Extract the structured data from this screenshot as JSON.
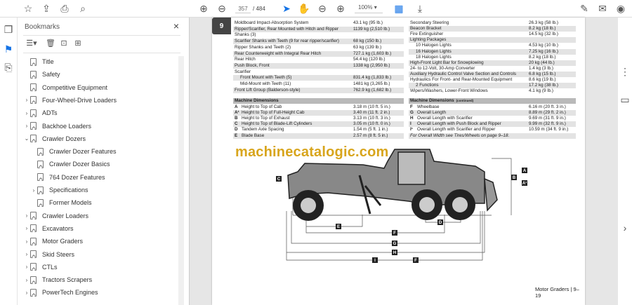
{
  "toolbar": {
    "page_current": "357",
    "page_total": "/ 484",
    "zoom": "100%",
    "icons": [
      "star-icon",
      "upload-icon",
      "print-icon",
      "search-icon",
      "page-up-icon",
      "page-down-icon",
      "select-cursor-icon",
      "hand-icon",
      "zoom-out-icon",
      "zoom-in-icon",
      "page-display-icon",
      "scroll-mode-icon",
      "sign-icon",
      "share-mail-icon",
      "account-icon"
    ]
  },
  "bookmarks": {
    "title": "Bookmarks",
    "close": "×",
    "items": [
      {
        "label": "Title",
        "level": 0,
        "expand": ""
      },
      {
        "label": "Safety",
        "level": 0,
        "expand": ""
      },
      {
        "label": "Competitive Equipment",
        "level": 0,
        "expand": ""
      },
      {
        "label": "Four-Wheel-Drive Loaders",
        "level": 0,
        "expand": "›"
      },
      {
        "label": "ADTs",
        "level": 0,
        "expand": "›"
      },
      {
        "label": "Backhoe Loaders",
        "level": 0,
        "expand": "›"
      },
      {
        "label": "Crawler Dozers",
        "level": 0,
        "expand": "⌄"
      },
      {
        "label": "Crawler Dozer Features",
        "level": 1,
        "expand": ""
      },
      {
        "label": "Crawler Dozer Basics",
        "level": 1,
        "expand": ""
      },
      {
        "label": "764 Dozer Features",
        "level": 1,
        "expand": ""
      },
      {
        "label": "Specifications",
        "level": 1,
        "expand": "›"
      },
      {
        "label": "Former Models",
        "level": 1,
        "expand": ""
      },
      {
        "label": "Crawler Loaders",
        "level": 0,
        "expand": "›"
      },
      {
        "label": "Excavators",
        "level": 0,
        "expand": "›"
      },
      {
        "label": "Motor Graders",
        "level": 0,
        "expand": "›"
      },
      {
        "label": "Skid Steers",
        "level": 0,
        "expand": "›"
      },
      {
        "label": "CTLs",
        "level": 0,
        "expand": "›"
      },
      {
        "label": "Tractors Scrapers",
        "level": 0,
        "expand": "›"
      },
      {
        "label": "PowerTech Engines",
        "level": 0,
        "expand": "›"
      }
    ]
  },
  "doc": {
    "left_options": [
      [
        "Moldboard Impact-Absorption System",
        "43.1 kg (95 lb.)",
        0
      ],
      [
        "Ripper/Scarifier, Rear Mounted with Hitch and Ripper",
        "1139 kg (2,510 lb.)",
        0
      ],
      [
        "Shanks (3)",
        "",
        0
      ],
      [
        "Scarifier Shanks with Teeth (9 for rear ripper/scarifier)",
        "68 kg (150 lb.)",
        0
      ],
      [
        "Ripper Shanks and Teeth (2)",
        "63 kg (139 lb.)",
        0
      ],
      [
        "Rear Counterweight with Integral Rear Hitch",
        "727.1 kg (1,603 lb.)",
        0
      ],
      [
        "Rear Hitch",
        "54.4 kg (120 lb.)",
        0
      ],
      [
        "Push Block, Front",
        "1338 kg (2,950 lb.)",
        0
      ],
      [
        "Scarifier",
        "",
        0
      ],
      [
        "Front Mount with Teeth (5)",
        "831.4 kg (1,833 lb.)",
        1
      ],
      [
        "Mid-Mount with Teeth (11)",
        "1481 kg (3,265 lb.)",
        1
      ],
      [
        "Front Lift Group (Balderson-style)",
        "762.9 kg (1,682 lb.)",
        0
      ]
    ],
    "right_options": [
      [
        "Secondary Steering",
        "26.3 kg (58 lb.)",
        0
      ],
      [
        "Beacon Bracket",
        "8.2 kg (18 lb.)",
        0
      ],
      [
        "Fire Extinguisher",
        "14.5 kg (32 lb.)",
        0
      ],
      [
        "Lighting Packages",
        "",
        0
      ],
      [
        "10 Halogen Lights",
        "4.53 kg (10 lb.)",
        1
      ],
      [
        "16 Halogen Lights",
        "7.25 kg (16 lb.)",
        1
      ],
      [
        "18 Halogen Lights",
        "8.2 kg (18 lb.)",
        1
      ],
      [
        "High-Front Light Bar for Snowplowing",
        "20 kg (44 lb.)",
        0
      ],
      [
        "24- to 12-Volt, 30-Amp Converter",
        "1.4 kg (3 lb.)",
        0
      ],
      [
        "Auxiliary Hydraulic Control Valve Section and Controls",
        "6.8 kg (15 lb.)",
        0
      ],
      [
        "Hydraulics For Front- and Rear-Mounted Equipment",
        "8.6 kg (19 lb.)",
        0
      ],
      [
        "2 Functions",
        "17.2 kg (38 lb.)",
        1
      ],
      [
        "Wipers/Washers, Lower-Front Windows",
        "4.1 kg (9 lb.)",
        0
      ]
    ],
    "dim_left_title": "Machine Dimensions",
    "dim_left": [
      [
        "A",
        "Height to Top of Cab",
        "3.18 m (10 ft. 5 in.)"
      ],
      [
        "A¹",
        "Height to Top of Full-Height Cab",
        "3.40 m (11 ft. 2 in.)"
      ],
      [
        "B",
        "Height to Top of Exhaust",
        "3.13 m (10 ft. 3 in.)"
      ],
      [
        "C",
        "Height to Top of Blade-Lift Cylinders",
        "3.05 m (10 ft. 0 in.)"
      ],
      [
        "D",
        "Tandem Axle Spacing",
        "1.54 m (5 ft. 1 in.)"
      ],
      [
        "E",
        "Blade Base",
        "2.57 m (8 ft. 5 in.)"
      ]
    ],
    "dim_right_title": "Machine Dimensions",
    "dim_right_suffix": "(continued)",
    "dim_right": [
      [
        "F",
        "Wheelbase",
        "6.16 m (20 ft. 3 in.)"
      ],
      [
        "G",
        "Overall Length",
        "8.89 m (29 ft. 2 in.)"
      ],
      [
        "H",
        "Overall Length with Scarifier",
        "9.69 m (31 ft. 9 in.)"
      ],
      [
        "I",
        "Overall Length with Push Block and Ripper",
        "9.99 m (32 ft. 9 in.)"
      ],
      [
        "I¹",
        "Overall Length with Scarifier and Ripper",
        "10.59 m (34 ft. 9 in.)"
      ]
    ],
    "dim_note": "For Overall Width see Tires/Wheels on page 9–18.",
    "diagram_labels": [
      "A",
      "B",
      "A¹",
      "C",
      "D",
      "E",
      "F",
      "G",
      "H",
      "I",
      "F"
    ],
    "watermark": "machinecatalogic.com",
    "footer": "Motor Graders  |  9–19",
    "section_tab": "9"
  }
}
